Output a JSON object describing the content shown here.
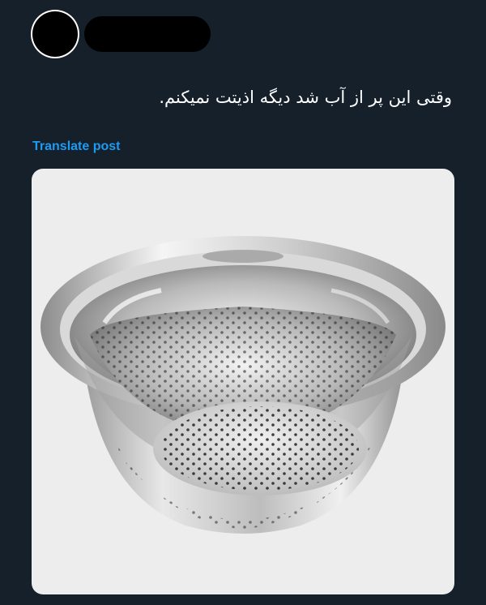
{
  "post": {
    "avatar_icon": "user-avatar-redacted",
    "author_name_redacted": true,
    "text": "وقتی این پر از آب شد دیگه اذیتت نمیکنم.",
    "translate_label": "Translate post"
  },
  "media": {
    "description_icon": "colander-bowl-image"
  },
  "colors": {
    "background": "#15202b",
    "link": "#1d9bf0",
    "text": "#ffffff",
    "image_bg": "#ededed"
  }
}
